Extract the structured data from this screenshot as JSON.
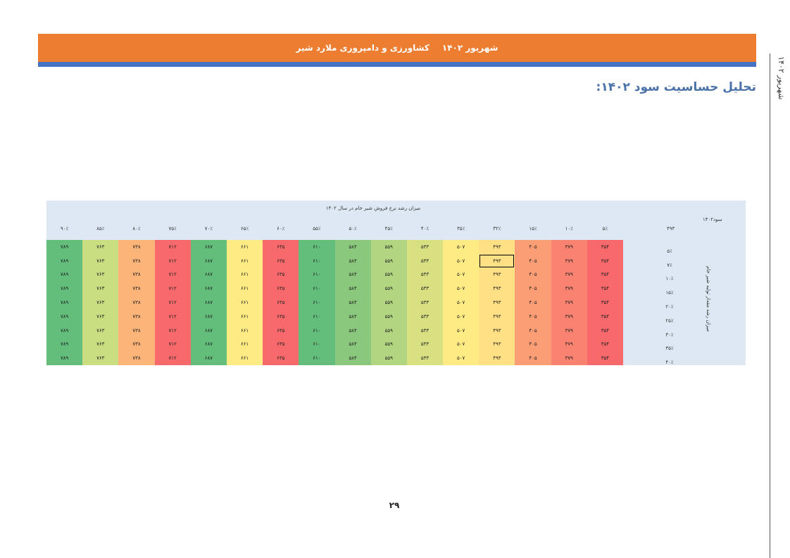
{
  "header": {
    "line_left": "کشاورزی و دامپروری ملارد شیر",
    "line_right": "شهریور ۱۴۰۲"
  },
  "side_label": "شهریور ۱۴۰۲",
  "section_title": "تحلیل حساسیت سود ۱۴۰۲:",
  "table": {
    "caption": "میزان رشد نرخ فروش شیر خام در سال ۱۴۰۲",
    "profit_label": "سود۱۴۰۲",
    "corner_value": "۴۹۳",
    "vertical_label": "میزان رشد مقدار تولید شیر خام",
    "columns": [
      "۵٪",
      "۱۰٪",
      "۱۵٪",
      "۳۲٪",
      "۳۵٪",
      "۴۰٪",
      "۴۵٪",
      "۵۰٪",
      "۵۵٪",
      "۶۰٪",
      "۶۵٪",
      "۷۰٪",
      "۷۵٪",
      "۸۰٪",
      "۸۵٪",
      "۹۰٪"
    ],
    "rows": [
      "۵٪",
      "۷٪",
      "۱۰٪",
      "۱۵٪",
      "۲۰٪",
      "۲۵٪",
      "۳۰٪",
      "۳۵٪",
      "۴۰٪"
    ],
    "values": [
      "۳۵۴",
      "۳۷۹",
      "۴۰۵",
      "۴۹۳",
      "۵۰۷",
      "۵۳۳",
      "۵۵۹",
      "۵۸۴",
      "۶۱۰",
      "۶۳۵",
      "۶۶۱",
      "۶۸۷",
      "۷۱۲",
      "۷۳۸",
      "۷۶۳",
      "۷۸۹"
    ],
    "colors": [
      "#f8696b",
      "#f98370",
      "#fb9d75",
      "#ffe084",
      "#ffeb84",
      "#d8e082",
      "#b1d580",
      "#8ac97d",
      "#63be7b",
      "#f8696b",
      "#ffeb84",
      "#63be7b",
      "#f8696b",
      "#fcb479",
      "#c9de81",
      "#63be7b"
    ],
    "selected": {
      "row": 1,
      "col": 3
    }
  },
  "page_number": "۲۹"
}
